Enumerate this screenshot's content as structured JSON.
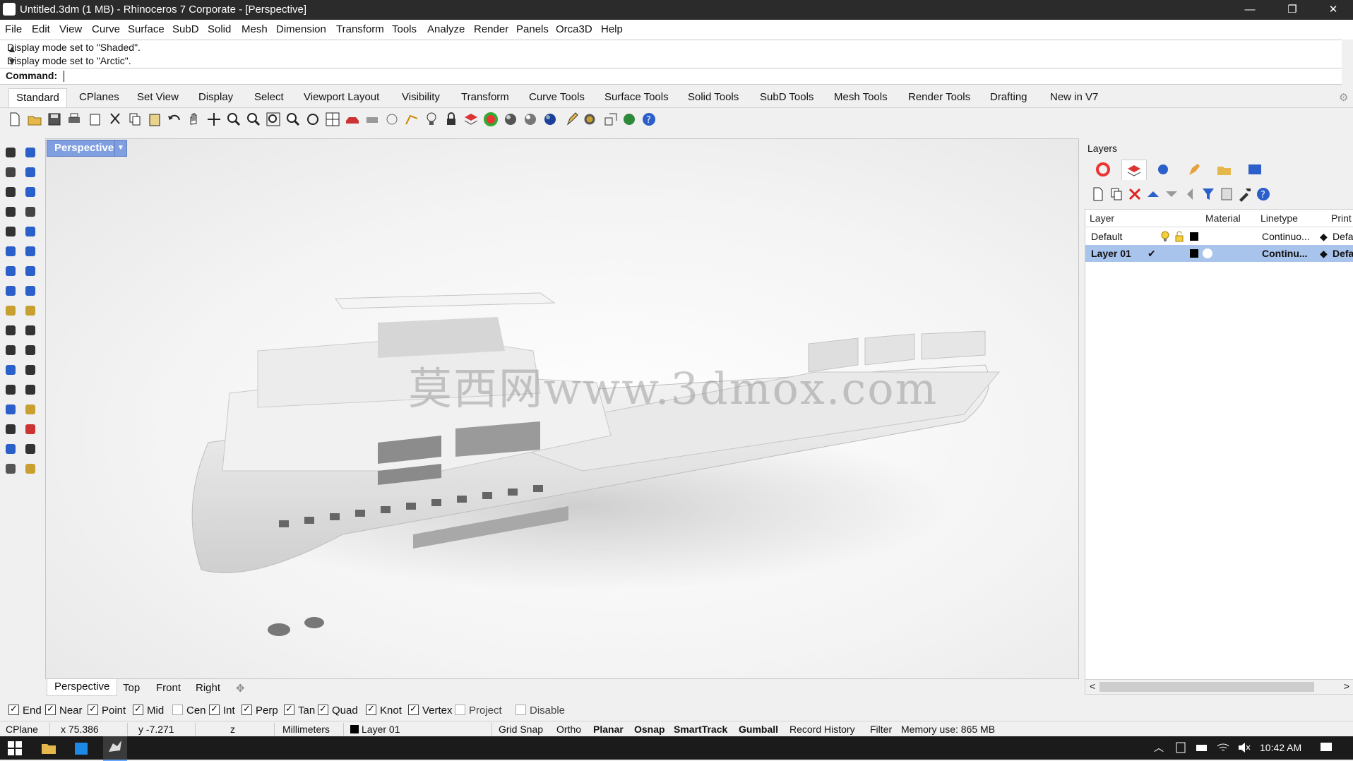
{
  "window": {
    "title": "Untitled.3dm (1 MB) - Rhinoceros 7 Corporate - [Perspective]",
    "minimize": "—",
    "maximize": "❐",
    "close": "✕"
  },
  "menu": [
    "File",
    "Edit",
    "View",
    "Curve",
    "Surface",
    "SubD",
    "Solid",
    "Mesh",
    "Dimension",
    "Transform",
    "Tools",
    "Analyze",
    "Render",
    "Panels",
    "Orca3D",
    "Help"
  ],
  "command": {
    "history": [
      "Display mode set to \"Shaded\".",
      "Display mode set to \"Arctic\"."
    ],
    "prompt_label": "Command:",
    "value": ""
  },
  "toolbar_tabs": [
    "Standard",
    "CPlanes",
    "Set View",
    "Display",
    "Select",
    "Viewport Layout",
    "Visibility",
    "Transform",
    "Curve Tools",
    "Surface Tools",
    "Solid Tools",
    "SubD Tools",
    "Mesh Tools",
    "Render Tools",
    "Drafting",
    "New in V7"
  ],
  "active_toolbar_tab": "Standard",
  "toolbar_icons": [
    "new-file-icon",
    "open-file-icon",
    "save-icon",
    "print-icon",
    "export-icon",
    "cut-icon",
    "copy-icon",
    "paste-icon",
    "undo-icon",
    "pan-hand-icon",
    "move-view-icon",
    "zoom-icon",
    "zoom-window-icon",
    "zoom-extents-icon",
    "zoom-selected-icon",
    "rotate-view-icon",
    "four-viewports-icon",
    "car-icon",
    "camera-icon",
    "circle-icon",
    "named-cplane-icon",
    "lightbulb-icon",
    "lock-icon",
    "layer-icon",
    "color-wheel-icon",
    "sphere-shaded-icon",
    "sphere-render-icon",
    "sphere-blue-icon",
    "pencil-icon",
    "gear-icon",
    "resize-icon",
    "globe-icon",
    "help-icon"
  ],
  "viewport": {
    "name": "Perspective",
    "dropdown": "▼",
    "watermark": "莫西网www.3dmox.com"
  },
  "viewport_tabs": [
    "Perspective",
    "Top",
    "Front",
    "Right"
  ],
  "viewport_tab_add": "✥",
  "layers_panel": {
    "title": "Layers",
    "columns": [
      "Layer",
      "Material",
      "Linetype",
      "Print"
    ],
    "rows": [
      {
        "name": "Default",
        "current": "",
        "linetype": "Continuo...",
        "print": "Defa",
        "color": "#000000",
        "selected": false
      },
      {
        "name": "Layer 01",
        "current": "✔",
        "linetype": "Continu...",
        "print": "Defa",
        "color": "#000000",
        "selected": true
      }
    ],
    "scroll_left": "<",
    "scroll_right": ">"
  },
  "osnaps": [
    {
      "label": "End",
      "checked": true
    },
    {
      "label": "Near",
      "checked": true
    },
    {
      "label": "Point",
      "checked": true
    },
    {
      "label": "Mid",
      "checked": true
    },
    {
      "label": "Cen",
      "checked": false
    },
    {
      "label": "Int",
      "checked": true
    },
    {
      "label": "Perp",
      "checked": true
    },
    {
      "label": "Tan",
      "checked": true
    },
    {
      "label": "Quad",
      "checked": true
    },
    {
      "label": "Knot",
      "checked": true
    },
    {
      "label": "Vertex",
      "checked": true
    },
    {
      "label": "Project",
      "checked": false
    },
    {
      "label": "Disable",
      "checked": false
    }
  ],
  "status": {
    "cplane": "CPlane",
    "x": "x 75.386",
    "y": "y -7.271",
    "z": "z",
    "units": "Millimeters",
    "layer": "Layer 01",
    "grid_snap": "Grid Snap",
    "ortho": "Ortho",
    "planar": "Planar",
    "osnap": "Osnap",
    "smarttrack": "SmartTrack",
    "gumball": "Gumball",
    "record_history": "Record History",
    "filter": "Filter",
    "memory": "Memory use: 865 MB"
  },
  "taskbar": {
    "time": "10:42 AM"
  },
  "colors": {
    "viewport_tab": "#7f9fe0",
    "selected_row": "#a9c4ec",
    "titlebar": "#2b2b2b",
    "taskbar": "#1b1b1b"
  }
}
